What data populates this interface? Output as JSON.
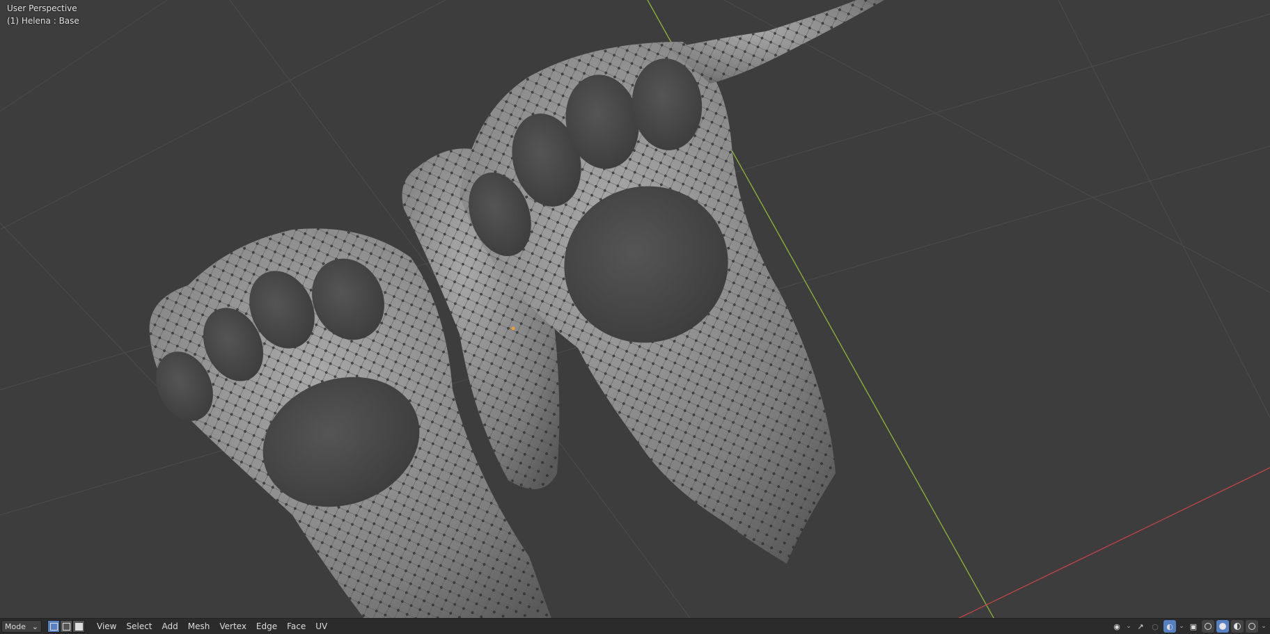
{
  "viewport": {
    "title": "User Perspective",
    "object_info": "(1) Helena : Base"
  },
  "header": {
    "mode_label": "Mode",
    "menus": [
      "View",
      "Select",
      "Add",
      "Mesh",
      "Vertex",
      "Edge",
      "Face",
      "UV"
    ]
  },
  "colors": {
    "background": "#3d3d3d",
    "grid": "#4a4a4a",
    "axis_y": "#8fb735",
    "axis_x": "#c14545",
    "mesh_surface": "#8a8a8a",
    "pad": "#4b4b4b",
    "vertex": "#0a0a0a",
    "origin": "#f0a030",
    "select_active": "#5680c2"
  },
  "icons": {
    "select_modes": [
      "vertex-select-icon",
      "edge-select-icon",
      "face-select-icon"
    ],
    "right": [
      "visibility-icon",
      "gizmo-icon",
      "overlay-icon",
      "xray-icon",
      "wireframe-shading-icon",
      "solid-shading-icon",
      "material-shading-icon",
      "rendered-shading-icon"
    ]
  }
}
